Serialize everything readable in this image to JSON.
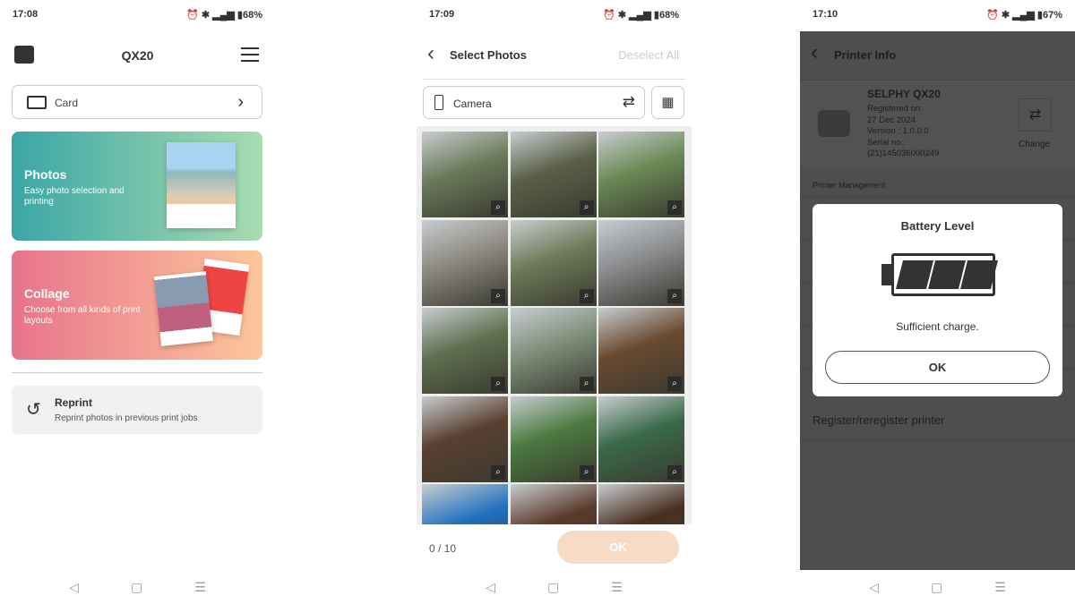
{
  "screens": [
    {
      "status": {
        "time": "17:08",
        "battery": "68%"
      },
      "header": {
        "title": "QX20",
        "left_icon": "printer-icon",
        "right_icon": "menu-icon"
      },
      "source": {
        "label": "Card",
        "icon": "card-icon"
      },
      "photos": {
        "title": "Photos",
        "subtitle": "Easy photo selection and printing"
      },
      "collage": {
        "title": "Collage",
        "subtitle": "Choose from all kinds of print layouts"
      },
      "reprint": {
        "title": "Reprint",
        "subtitle": "Reprint photos in previous print jobs"
      }
    },
    {
      "status": {
        "time": "17:09",
        "battery": "68%"
      },
      "header": {
        "title": "Select Photos",
        "action": "Deselect All"
      },
      "source": {
        "label": "Camera"
      },
      "footer": {
        "count": "0 / 10",
        "ok": "OK"
      },
      "thumbs": [
        "#6b7a5a",
        "#5a6048",
        "#6a8a55",
        "#8d8a80",
        "#6e7a58",
        "#8a8c8e",
        "#5f7050",
        "#7e8f7a",
        "#6a4a30",
        "#5a4030",
        "#4a7a40",
        "#3a6a4a",
        "#2070c0",
        "#5a3a2a",
        "#4a3020"
      ]
    },
    {
      "status": {
        "time": "17:10",
        "battery": "67%"
      },
      "header": {
        "title": "Printer Info"
      },
      "printer": {
        "name": "SELPHY QX20",
        "registered_label": "Registered on:",
        "registered": "27 Dec 2024",
        "version": "Version : 1.0.0.0",
        "serial_label": "Serial no.:",
        "serial": "(21)145036000249",
        "change": "Change"
      },
      "section": "Printer Management",
      "register": "Register/reregister printer",
      "dialog": {
        "title": "Battery Level",
        "message": "Sufficient charge.",
        "ok": "OK",
        "battery_bars": 3,
        "battery_bars_max": 3
      }
    }
  ],
  "colors": {
    "photos_gradient": [
      "#3aa6a6",
      "#a8dcb0"
    ],
    "collage_gradient": [
      "#e8738c",
      "#fcc79a"
    ],
    "ok_disabled": "#f6dcc4"
  }
}
